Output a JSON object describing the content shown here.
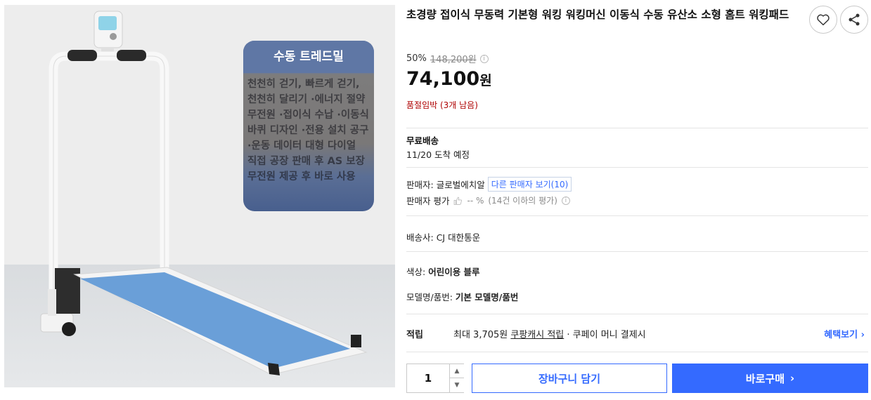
{
  "product": {
    "title": "초경량 접이식 무동력 기본형 워킹 워킹머신 이동식 수동 유산소 소형 홈트 워킹패드",
    "image_badge": {
      "title": "수동 트레드밀",
      "body": "천천히 걷기, 빠르게 걷기, 천천히 달리기 ·에너지 절약 무전원 ·접이식 수납 ·이동식 바퀴 디자인 ·전용 설치 공구 ·운동 데이터 대형 다이얼 직접 공장 판매 후 AS 보장 무전원 제공 후 바로 사용"
    }
  },
  "price": {
    "discount_rate": "50%",
    "original": "148,200원",
    "info_icon": "i",
    "sale_amount": "74,100",
    "sale_unit": "원",
    "stock_note": "품절임박 (3개 남음)"
  },
  "shipping": {
    "label": "무료배송",
    "arrival": "11/20 도착 예정"
  },
  "seller": {
    "label": "판매자:",
    "name": "글로벌에치알",
    "other_sellers": "다른 판매자 보기(10)",
    "rating_label": "판매자 평가",
    "rating_score": "-- %",
    "rating_note": "(14건 이하의 평가)",
    "rating_info_icon": "i"
  },
  "courier": {
    "label": "배송사:",
    "value": "CJ 대한통운"
  },
  "options": {
    "color_label": "색상:",
    "color_value": "어린이용 블루",
    "model_label": "모델명/품번:",
    "model_value": "기본 모델명/품번"
  },
  "reward": {
    "label": "적립",
    "prefix": "최대 3,705원",
    "link": "쿠팡캐시 적립",
    "suffix": "· 쿠페이 머니 결제시",
    "benefits_link": "혜택보기 ›"
  },
  "purchase": {
    "quantity": "1",
    "up_arrow": "▲",
    "down_arrow": "▼",
    "cart_label": "장바구니 담기",
    "buy_label": "바로구매",
    "buy_arrow": "›"
  },
  "colors": {
    "accent": "#346aff",
    "stock_red": "#ae0000",
    "belt_blue": "#6a9fd8"
  },
  "icons": {
    "heart": "heart-icon",
    "share": "share-icon",
    "info": "info-icon",
    "thumb": "thumbs-up-icon"
  }
}
